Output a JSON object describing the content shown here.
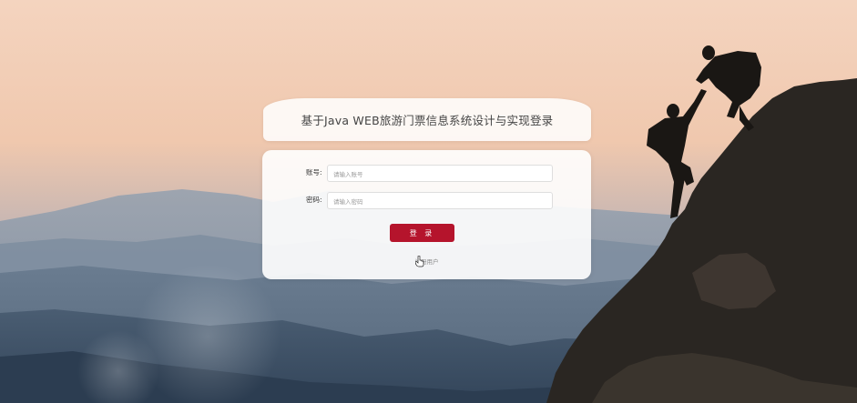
{
  "login": {
    "title": "基于Java WEB旅游门票信息系统设计与实现登录",
    "account_label": "账号:",
    "account_placeholder": "请输入账号",
    "password_label": "密码:",
    "password_placeholder": "请输入密码",
    "login_button": "登 录",
    "register_link": "注册用户"
  },
  "colors": {
    "accent": "#b5142c",
    "sky_top": "#f3cdb2",
    "mountain": "#4a5b6e"
  },
  "icons": {
    "cursor": "hand-pointer-icon"
  }
}
